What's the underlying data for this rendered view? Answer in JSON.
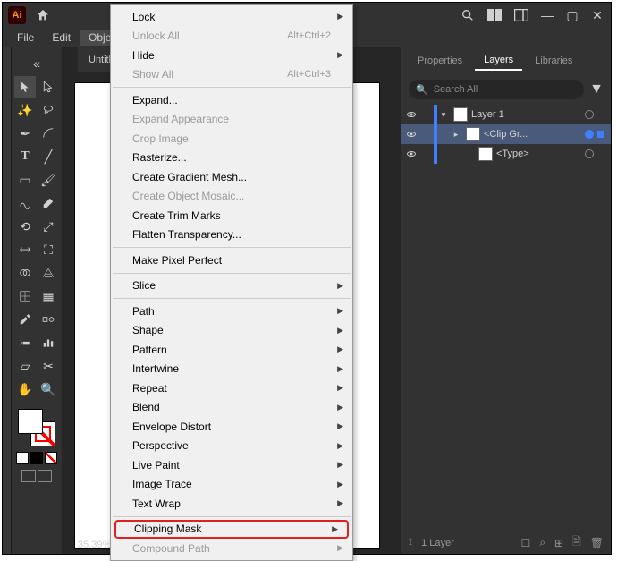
{
  "app": {
    "logo_text": "Ai"
  },
  "menubar": {
    "items": [
      "File",
      "Edit",
      "Object"
    ]
  },
  "doc": {
    "tab_title": "Untitle",
    "zoom": "35.39%"
  },
  "panels": {
    "tabs": [
      "Properties",
      "Layers",
      "Libraries"
    ],
    "search_placeholder": "Search All",
    "footer_label": "1 Layer"
  },
  "layers": [
    {
      "name": "Layer 1",
      "depth": 0,
      "expandable": true,
      "selected": false,
      "target": "ring",
      "selbox": false,
      "visible": true
    },
    {
      "name": "<Clip Gr...",
      "depth": 1,
      "expandable": true,
      "selected": true,
      "target": "filled",
      "selbox": true,
      "visible": true
    },
    {
      "name": "<Type>",
      "depth": 2,
      "expandable": false,
      "selected": false,
      "target": "ring",
      "selbox": false,
      "visible": true
    }
  ],
  "menu": {
    "sections": [
      [
        {
          "label": "Lock",
          "submenu": true
        },
        {
          "label": "Unlock All",
          "shortcut": "Alt+Ctrl+2",
          "disabled": true
        },
        {
          "label": "Hide",
          "submenu": true
        },
        {
          "label": "Show All",
          "shortcut": "Alt+Ctrl+3",
          "disabled": true
        }
      ],
      [
        {
          "label": "Expand..."
        },
        {
          "label": "Expand Appearance",
          "disabled": true
        },
        {
          "label": "Crop Image",
          "disabled": true
        },
        {
          "label": "Rasterize..."
        },
        {
          "label": "Create Gradient Mesh..."
        },
        {
          "label": "Create Object Mosaic...",
          "disabled": true
        },
        {
          "label": "Create Trim Marks"
        },
        {
          "label": "Flatten Transparency..."
        }
      ],
      [
        {
          "label": "Make Pixel Perfect"
        }
      ],
      [
        {
          "label": "Slice",
          "submenu": true
        }
      ],
      [
        {
          "label": "Path",
          "submenu": true
        },
        {
          "label": "Shape",
          "submenu": true
        },
        {
          "label": "Pattern",
          "submenu": true
        },
        {
          "label": "Intertwine",
          "submenu": true
        },
        {
          "label": "Repeat",
          "submenu": true
        },
        {
          "label": "Blend",
          "submenu": true
        },
        {
          "label": "Envelope Distort",
          "submenu": true
        },
        {
          "label": "Perspective",
          "submenu": true
        },
        {
          "label": "Live Paint",
          "submenu": true
        },
        {
          "label": "Image Trace",
          "submenu": true
        },
        {
          "label": "Text Wrap",
          "submenu": true
        }
      ],
      [
        {
          "label": "Clipping Mask",
          "submenu": true,
          "highlighted": true
        },
        {
          "label": "Compound Path",
          "submenu": true,
          "disabled": true
        }
      ]
    ]
  }
}
